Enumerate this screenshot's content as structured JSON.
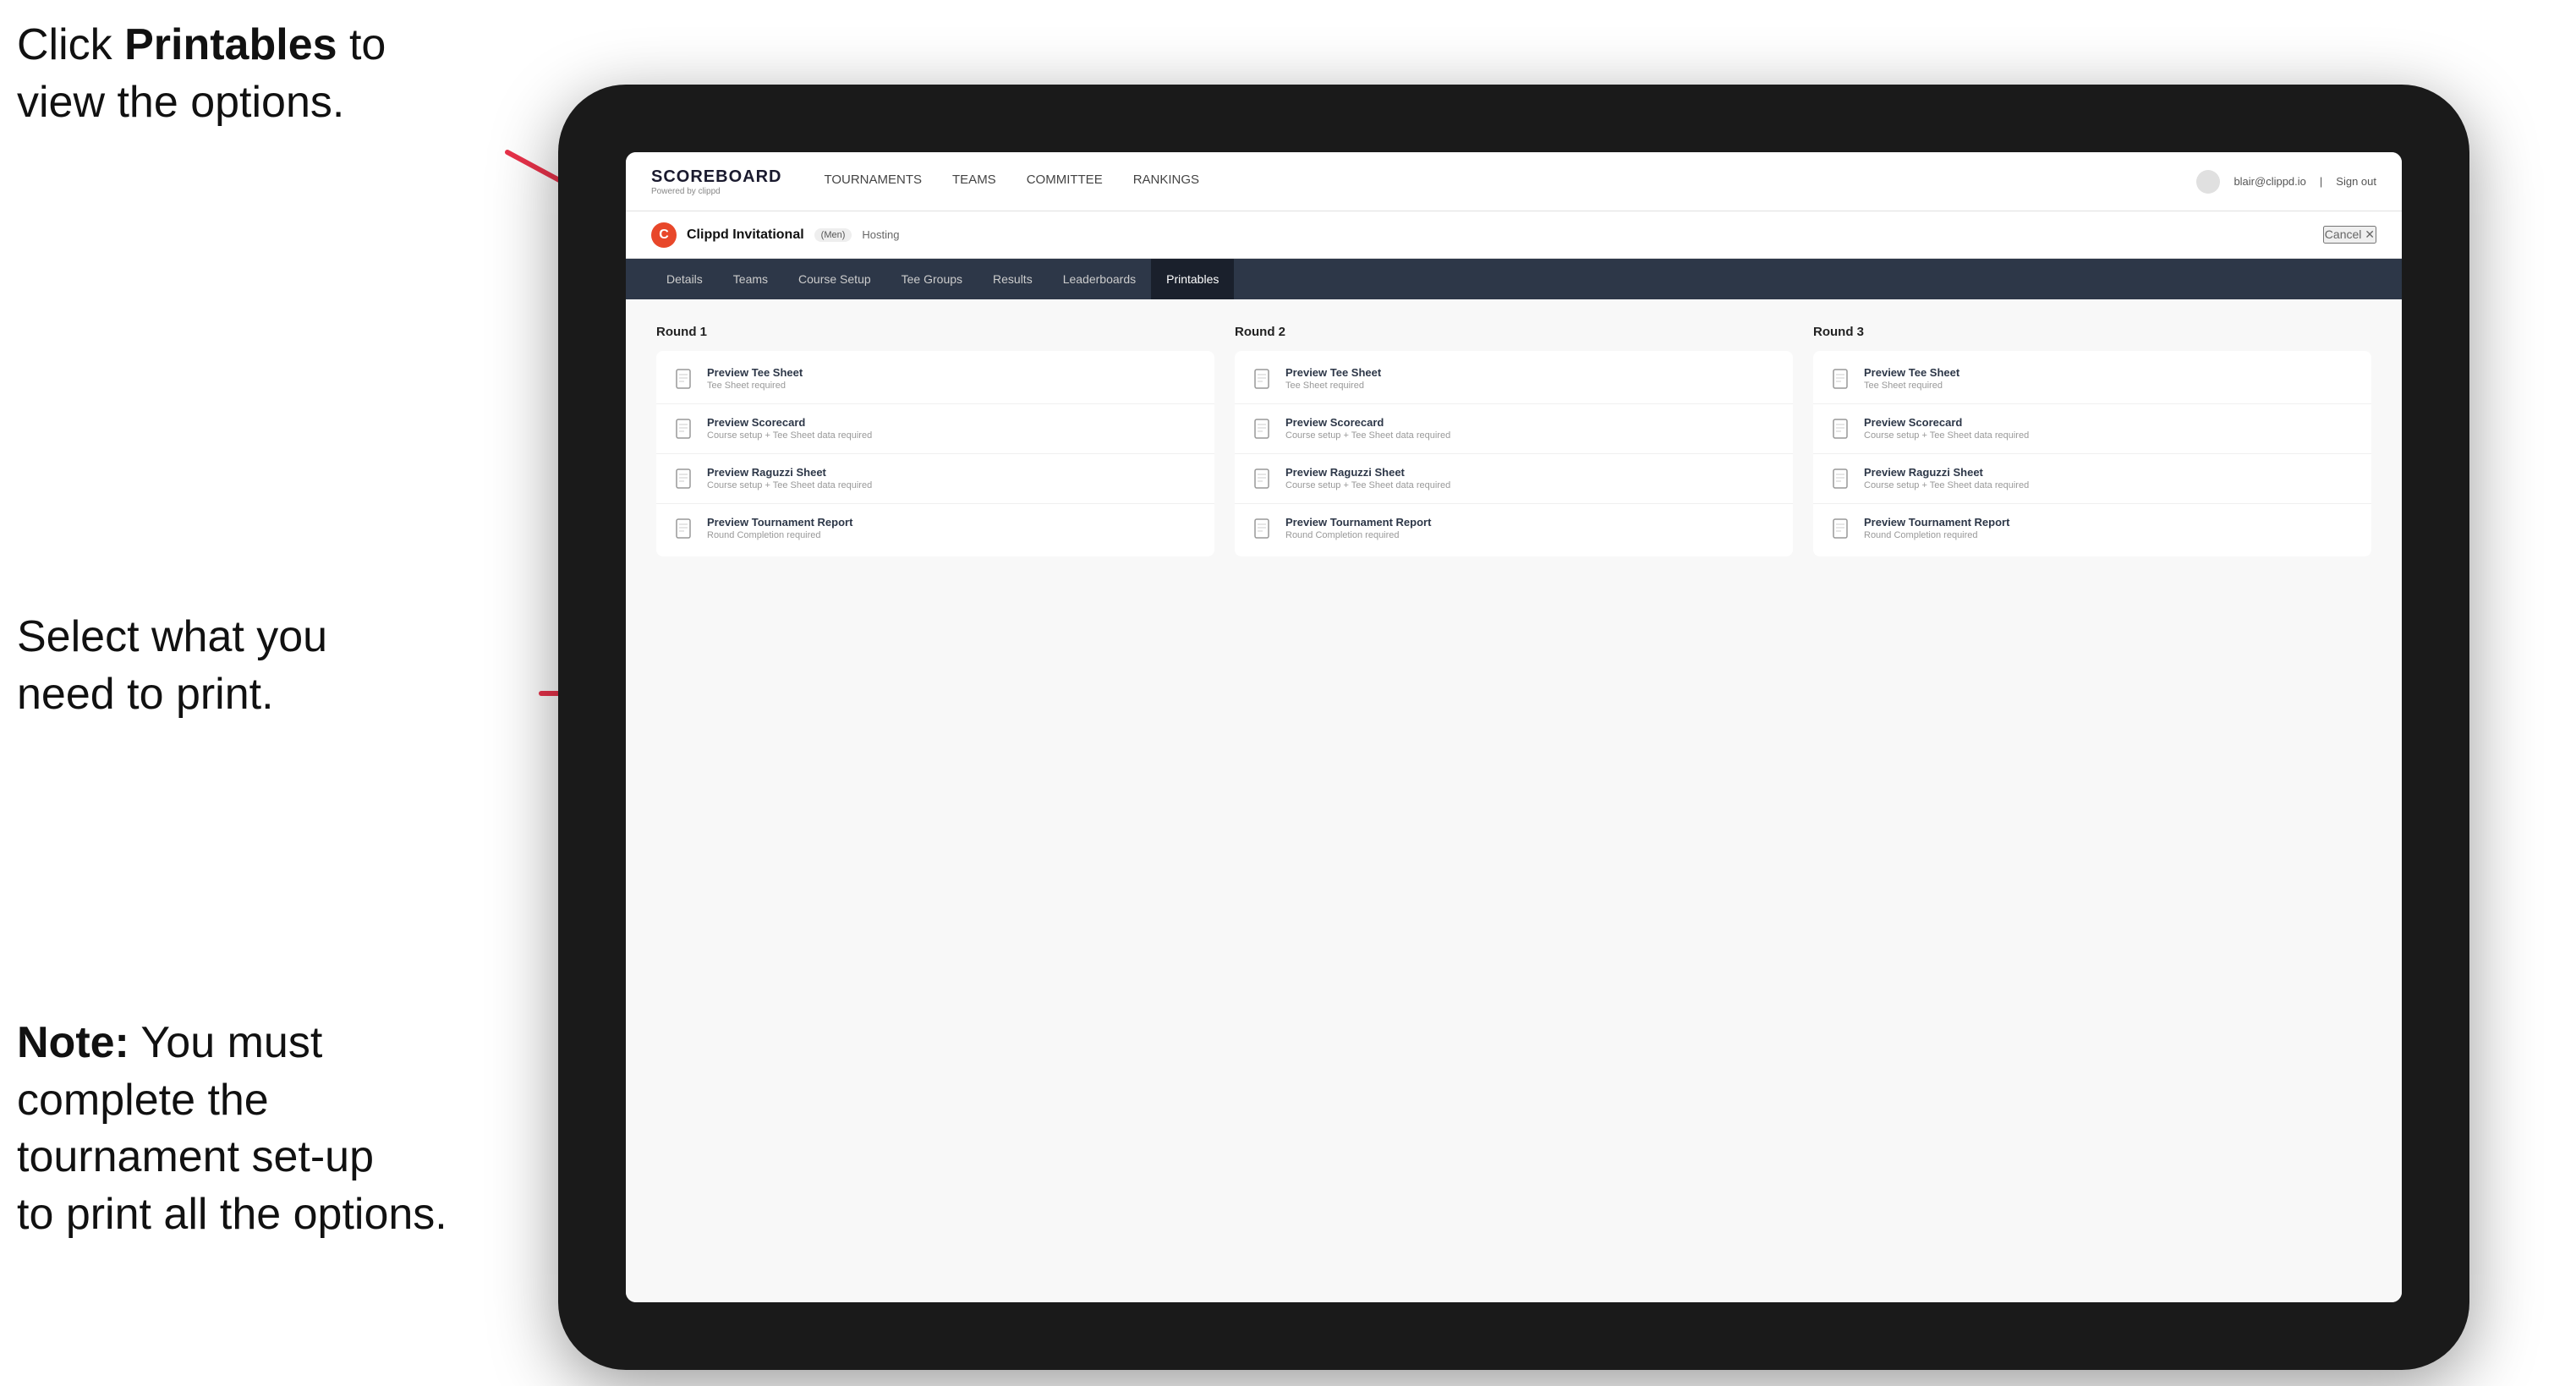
{
  "instructions": {
    "top": "Click ",
    "top_bold": "Printables",
    "top_rest": " to\nview the options.",
    "mid": "Select what you\nneed to print.",
    "bottom_bold": "Note:",
    "bottom_rest": " You must\ncomplete the\ntournament set-up\nto print all the options."
  },
  "nav": {
    "logo_title": "SCOREBOARD",
    "logo_sub": "Powered by clippd",
    "links": [
      {
        "label": "TOURNAMENTS",
        "active": false
      },
      {
        "label": "TEAMS",
        "active": false
      },
      {
        "label": "COMMITTEE",
        "active": false
      },
      {
        "label": "RANKINGS",
        "active": false
      }
    ],
    "user_email": "blair@clippd.io",
    "sign_in_out": "Sign out"
  },
  "tournament": {
    "logo_letter": "C",
    "name": "Clippd Invitational",
    "type": "(Men)",
    "status": "Hosting",
    "cancel": "Cancel ✕"
  },
  "tabs": [
    {
      "label": "Details",
      "active": false
    },
    {
      "label": "Teams",
      "active": false
    },
    {
      "label": "Course Setup",
      "active": false
    },
    {
      "label": "Tee Groups",
      "active": false
    },
    {
      "label": "Results",
      "active": false
    },
    {
      "label": "Leaderboards",
      "active": false
    },
    {
      "label": "Printables",
      "active": true
    }
  ],
  "rounds": [
    {
      "title": "Round 1",
      "items": [
        {
          "label": "Preview Tee Sheet",
          "sub": "Tee Sheet required"
        },
        {
          "label": "Preview Scorecard",
          "sub": "Course setup + Tee Sheet data required"
        },
        {
          "label": "Preview Raguzzi Sheet",
          "sub": "Course setup + Tee Sheet data required"
        },
        {
          "label": "Preview Tournament Report",
          "sub": "Round Completion required"
        }
      ]
    },
    {
      "title": "Round 2",
      "items": [
        {
          "label": "Preview Tee Sheet",
          "sub": "Tee Sheet required"
        },
        {
          "label": "Preview Scorecard",
          "sub": "Course setup + Tee Sheet data required"
        },
        {
          "label": "Preview Raguzzi Sheet",
          "sub": "Course setup + Tee Sheet data required"
        },
        {
          "label": "Preview Tournament Report",
          "sub": "Round Completion required"
        }
      ]
    },
    {
      "title": "Round 3",
      "items": [
        {
          "label": "Preview Tee Sheet",
          "sub": "Tee Sheet required"
        },
        {
          "label": "Preview Scorecard",
          "sub": "Course setup + Tee Sheet data required"
        },
        {
          "label": "Preview Raguzzi Sheet",
          "sub": "Course setup + Tee Sheet data required"
        },
        {
          "label": "Preview Tournament Report",
          "sub": "Round Completion required"
        }
      ]
    }
  ]
}
